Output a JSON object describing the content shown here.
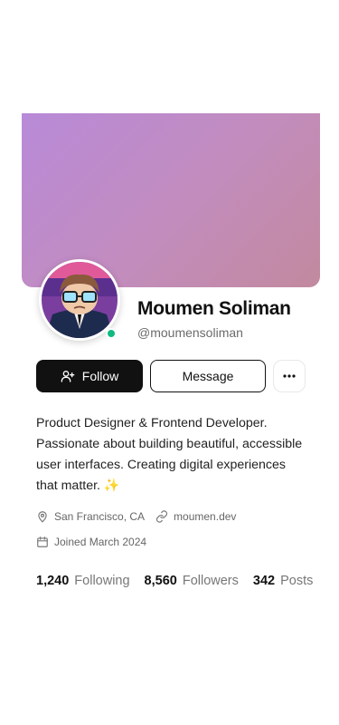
{
  "profile": {
    "name": "Moumen Soliman",
    "handle": "@moumensoliman",
    "online": true
  },
  "actions": {
    "follow_label": "Follow",
    "message_label": "Message",
    "more_label": "···"
  },
  "bio": "Product Designer & Frontend Developer. Passionate about building beautiful, accessible user interfaces. Creating digital experiences that matter. ✨",
  "meta": {
    "location": "San Francisco, CA",
    "website": "moumen.dev",
    "joined": "Joined March 2024"
  },
  "stats": [
    {
      "value": "1,240",
      "label": "Following"
    },
    {
      "value": "8,560",
      "label": "Followers"
    },
    {
      "value": "342",
      "label": "Posts"
    }
  ],
  "colors": {
    "accent": "#111111",
    "online": "#10b981",
    "cover_start": "#b88ad8",
    "cover_end": "#c28a9e"
  },
  "icons": [
    "user-plus-icon",
    "more-icon",
    "map-pin-icon",
    "link-icon",
    "calendar-icon"
  ]
}
